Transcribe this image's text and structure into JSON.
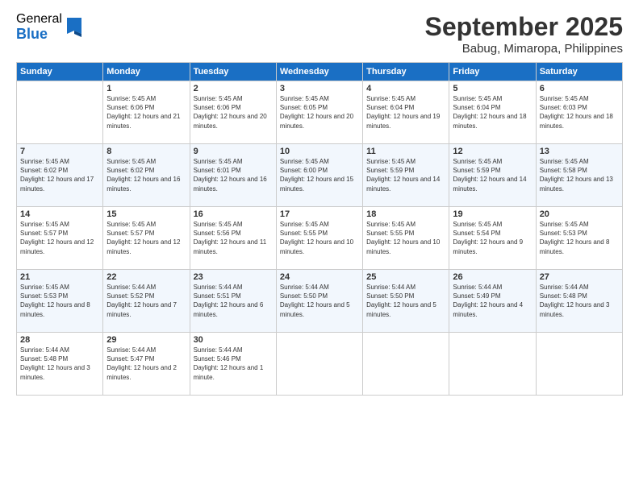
{
  "logo": {
    "general": "General",
    "blue": "Blue"
  },
  "header": {
    "month": "September 2025",
    "location": "Babug, Mimaropa, Philippines"
  },
  "days_of_week": [
    "Sunday",
    "Monday",
    "Tuesday",
    "Wednesday",
    "Thursday",
    "Friday",
    "Saturday"
  ],
  "weeks": [
    [
      {
        "day": "",
        "sunrise": "",
        "sunset": "",
        "daylight": ""
      },
      {
        "day": "1",
        "sunrise": "Sunrise: 5:45 AM",
        "sunset": "Sunset: 6:06 PM",
        "daylight": "Daylight: 12 hours and 21 minutes."
      },
      {
        "day": "2",
        "sunrise": "Sunrise: 5:45 AM",
        "sunset": "Sunset: 6:06 PM",
        "daylight": "Daylight: 12 hours and 20 minutes."
      },
      {
        "day": "3",
        "sunrise": "Sunrise: 5:45 AM",
        "sunset": "Sunset: 6:05 PM",
        "daylight": "Daylight: 12 hours and 20 minutes."
      },
      {
        "day": "4",
        "sunrise": "Sunrise: 5:45 AM",
        "sunset": "Sunset: 6:04 PM",
        "daylight": "Daylight: 12 hours and 19 minutes."
      },
      {
        "day": "5",
        "sunrise": "Sunrise: 5:45 AM",
        "sunset": "Sunset: 6:04 PM",
        "daylight": "Daylight: 12 hours and 18 minutes."
      },
      {
        "day": "6",
        "sunrise": "Sunrise: 5:45 AM",
        "sunset": "Sunset: 6:03 PM",
        "daylight": "Daylight: 12 hours and 18 minutes."
      }
    ],
    [
      {
        "day": "7",
        "sunrise": "Sunrise: 5:45 AM",
        "sunset": "Sunset: 6:02 PM",
        "daylight": "Daylight: 12 hours and 17 minutes."
      },
      {
        "day": "8",
        "sunrise": "Sunrise: 5:45 AM",
        "sunset": "Sunset: 6:02 PM",
        "daylight": "Daylight: 12 hours and 16 minutes."
      },
      {
        "day": "9",
        "sunrise": "Sunrise: 5:45 AM",
        "sunset": "Sunset: 6:01 PM",
        "daylight": "Daylight: 12 hours and 16 minutes."
      },
      {
        "day": "10",
        "sunrise": "Sunrise: 5:45 AM",
        "sunset": "Sunset: 6:00 PM",
        "daylight": "Daylight: 12 hours and 15 minutes."
      },
      {
        "day": "11",
        "sunrise": "Sunrise: 5:45 AM",
        "sunset": "Sunset: 5:59 PM",
        "daylight": "Daylight: 12 hours and 14 minutes."
      },
      {
        "day": "12",
        "sunrise": "Sunrise: 5:45 AM",
        "sunset": "Sunset: 5:59 PM",
        "daylight": "Daylight: 12 hours and 14 minutes."
      },
      {
        "day": "13",
        "sunrise": "Sunrise: 5:45 AM",
        "sunset": "Sunset: 5:58 PM",
        "daylight": "Daylight: 12 hours and 13 minutes."
      }
    ],
    [
      {
        "day": "14",
        "sunrise": "Sunrise: 5:45 AM",
        "sunset": "Sunset: 5:57 PM",
        "daylight": "Daylight: 12 hours and 12 minutes."
      },
      {
        "day": "15",
        "sunrise": "Sunrise: 5:45 AM",
        "sunset": "Sunset: 5:57 PM",
        "daylight": "Daylight: 12 hours and 12 minutes."
      },
      {
        "day": "16",
        "sunrise": "Sunrise: 5:45 AM",
        "sunset": "Sunset: 5:56 PM",
        "daylight": "Daylight: 12 hours and 11 minutes."
      },
      {
        "day": "17",
        "sunrise": "Sunrise: 5:45 AM",
        "sunset": "Sunset: 5:55 PM",
        "daylight": "Daylight: 12 hours and 10 minutes."
      },
      {
        "day": "18",
        "sunrise": "Sunrise: 5:45 AM",
        "sunset": "Sunset: 5:55 PM",
        "daylight": "Daylight: 12 hours and 10 minutes."
      },
      {
        "day": "19",
        "sunrise": "Sunrise: 5:45 AM",
        "sunset": "Sunset: 5:54 PM",
        "daylight": "Daylight: 12 hours and 9 minutes."
      },
      {
        "day": "20",
        "sunrise": "Sunrise: 5:45 AM",
        "sunset": "Sunset: 5:53 PM",
        "daylight": "Daylight: 12 hours and 8 minutes."
      }
    ],
    [
      {
        "day": "21",
        "sunrise": "Sunrise: 5:45 AM",
        "sunset": "Sunset: 5:53 PM",
        "daylight": "Daylight: 12 hours and 8 minutes."
      },
      {
        "day": "22",
        "sunrise": "Sunrise: 5:44 AM",
        "sunset": "Sunset: 5:52 PM",
        "daylight": "Daylight: 12 hours and 7 minutes."
      },
      {
        "day": "23",
        "sunrise": "Sunrise: 5:44 AM",
        "sunset": "Sunset: 5:51 PM",
        "daylight": "Daylight: 12 hours and 6 minutes."
      },
      {
        "day": "24",
        "sunrise": "Sunrise: 5:44 AM",
        "sunset": "Sunset: 5:50 PM",
        "daylight": "Daylight: 12 hours and 5 minutes."
      },
      {
        "day": "25",
        "sunrise": "Sunrise: 5:44 AM",
        "sunset": "Sunset: 5:50 PM",
        "daylight": "Daylight: 12 hours and 5 minutes."
      },
      {
        "day": "26",
        "sunrise": "Sunrise: 5:44 AM",
        "sunset": "Sunset: 5:49 PM",
        "daylight": "Daylight: 12 hours and 4 minutes."
      },
      {
        "day": "27",
        "sunrise": "Sunrise: 5:44 AM",
        "sunset": "Sunset: 5:48 PM",
        "daylight": "Daylight: 12 hours and 3 minutes."
      }
    ],
    [
      {
        "day": "28",
        "sunrise": "Sunrise: 5:44 AM",
        "sunset": "Sunset: 5:48 PM",
        "daylight": "Daylight: 12 hours and 3 minutes."
      },
      {
        "day": "29",
        "sunrise": "Sunrise: 5:44 AM",
        "sunset": "Sunset: 5:47 PM",
        "daylight": "Daylight: 12 hours and 2 minutes."
      },
      {
        "day": "30",
        "sunrise": "Sunrise: 5:44 AM",
        "sunset": "Sunset: 5:46 PM",
        "daylight": "Daylight: 12 hours and 1 minute."
      },
      {
        "day": "",
        "sunrise": "",
        "sunset": "",
        "daylight": ""
      },
      {
        "day": "",
        "sunrise": "",
        "sunset": "",
        "daylight": ""
      },
      {
        "day": "",
        "sunrise": "",
        "sunset": "",
        "daylight": ""
      },
      {
        "day": "",
        "sunrise": "",
        "sunset": "",
        "daylight": ""
      }
    ]
  ]
}
